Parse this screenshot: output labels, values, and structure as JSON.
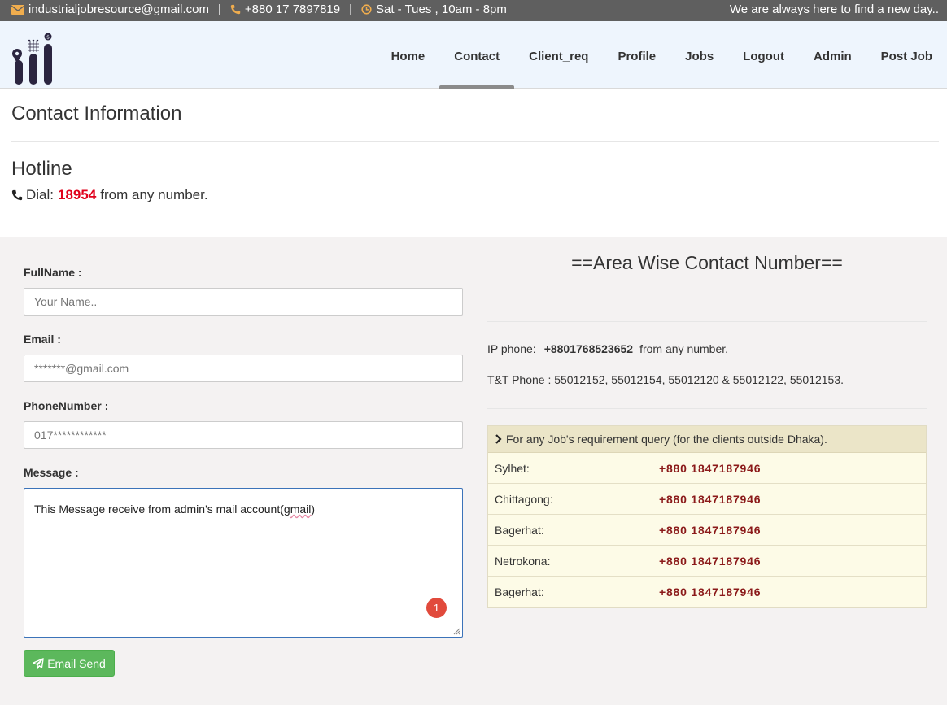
{
  "topbar": {
    "email": "industrialjobresource@gmail.com",
    "separator": "|",
    "phone": "+880 17 7897819",
    "hours": "Sat - Tues , 10am - 8pm",
    "tagline": "We are always here to find a new day.."
  },
  "nav": {
    "items": [
      {
        "label": "Home"
      },
      {
        "label": "Contact"
      },
      {
        "label": "Client_req"
      },
      {
        "label": "Profile"
      },
      {
        "label": "Jobs"
      },
      {
        "label": "Logout"
      },
      {
        "label": "Admin"
      },
      {
        "label": "Post Job"
      }
    ],
    "active": "Contact"
  },
  "page": {
    "title": "Contact Information",
    "hotline_title": "Hotline",
    "dial_prefix": "Dial:",
    "dial_number": "18954",
    "dial_suffix": "from any number."
  },
  "form": {
    "fullname_label": "FullName :",
    "fullname_placeholder": "Your Name..",
    "email_label": "Email :",
    "email_placeholder": "*******@gmail.com",
    "phone_label": "PhoneNumber :",
    "phone_placeholder": "017************",
    "message_label": "Message :",
    "message_text_before": "This Message receive from admin's mail account(",
    "message_text_spell": "gmail",
    "message_text_after": ")",
    "badge_count": "1",
    "send_label": "Email Send"
  },
  "area": {
    "title": "==Area Wise Contact Number==",
    "ip_label": "IP phone:",
    "ip_number": "+8801768523652",
    "ip_suffix": "from any number.",
    "tt_phone": "T&T Phone : 55012152, 55012154, 55012120 & 55012122, 55012153.",
    "table_header": "For any Job's requirement query (for the clients outside Dhaka).",
    "rows": [
      {
        "area": "Sylhet:",
        "phone": "+880 1847187946"
      },
      {
        "area": "Chittagong:",
        "phone": "+880 1847187946"
      },
      {
        "area": "Bagerhat:",
        "phone": "+880 1847187946"
      },
      {
        "area": "Netrokona:",
        "phone": "+880 1847187946"
      },
      {
        "area": "Bagerhat:",
        "phone": "+880 1847187946"
      }
    ]
  },
  "colors": {
    "accent_icon": "#f0ad4e",
    "hotline_number": "#e0001b",
    "send_button": "#5cb85c",
    "table_phone": "#8b1a1a"
  }
}
